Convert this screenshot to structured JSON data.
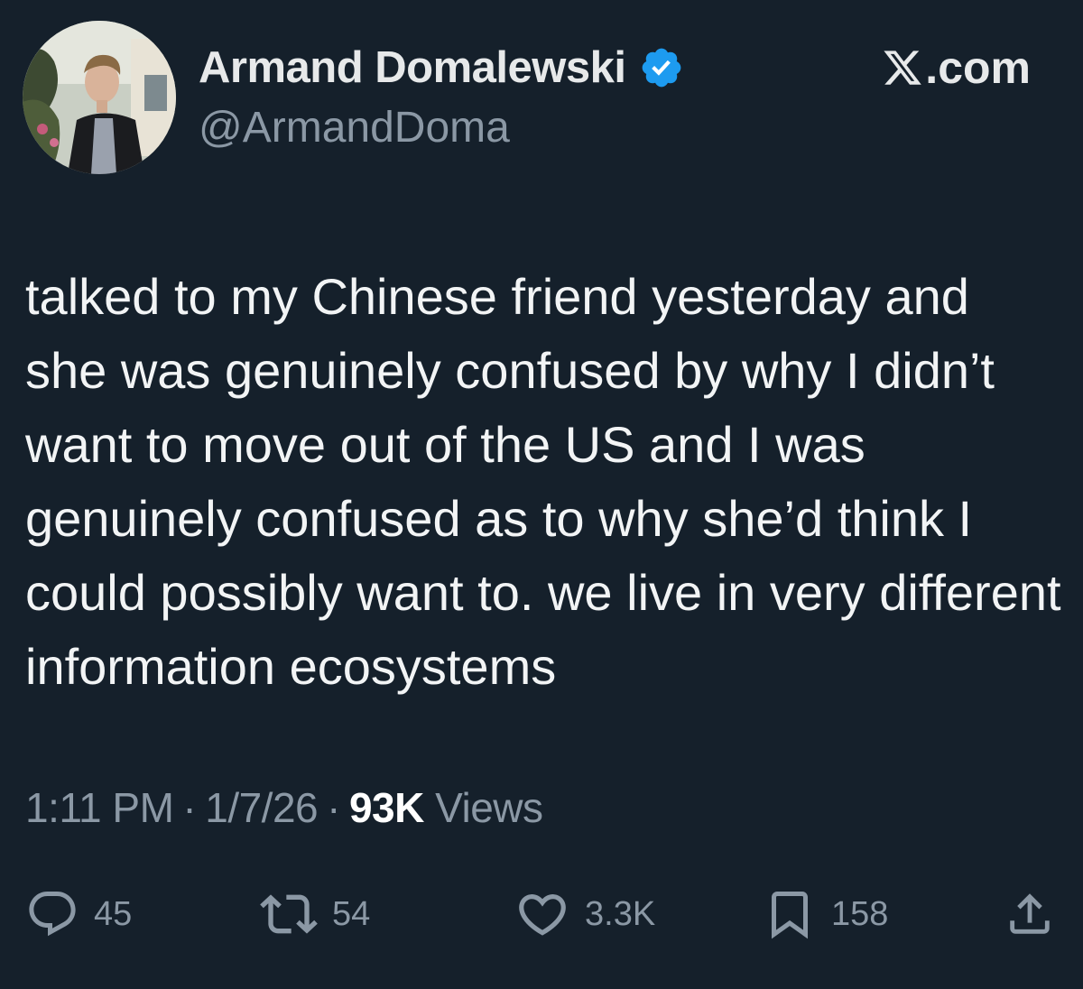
{
  "author": {
    "display_name": "Armand Domalewski",
    "handle": "@ArmandDoma",
    "verified": true,
    "verified_icon": "verified-badge-icon",
    "avatar_icon": "profile-photo"
  },
  "brand": {
    "label": ".com",
    "icon": "x-logo-icon"
  },
  "tweet": {
    "text": "talked to my Chinese friend yesterday and she was genuinely confused by why I didn’t want to move out of the US and I was genuinely confused as to why she’d think I could possibly want to. we live in very different information ecosystems"
  },
  "meta": {
    "time": "1:11 PM",
    "separator": "·",
    "date": "1/7/26",
    "views_count": "93K",
    "views_label": "Views"
  },
  "actions": {
    "reply": {
      "icon": "reply-icon",
      "count": "45"
    },
    "repost": {
      "icon": "repost-icon",
      "count": "54"
    },
    "like": {
      "icon": "heart-icon",
      "count": "3.3K"
    },
    "bookmark": {
      "icon": "bookmark-icon",
      "count": "158"
    },
    "share": {
      "icon": "share-icon"
    }
  },
  "colors": {
    "background": "#15202b",
    "primary_text": "#e7e9ea",
    "secondary_text": "#8b98a5",
    "verified_blue": "#1d9bf0"
  }
}
